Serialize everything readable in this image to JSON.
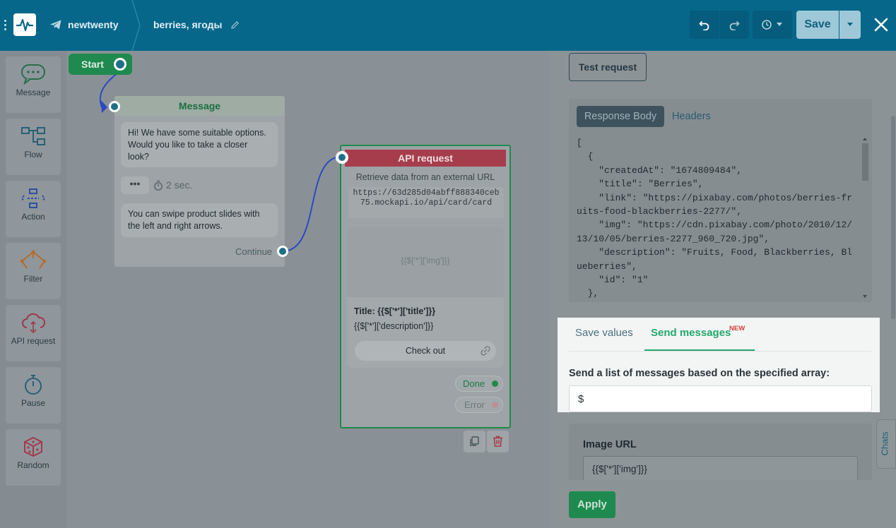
{
  "topbar": {
    "bot_name": "newtwenty",
    "flow_name": "berries, ягоды",
    "save_label": "Save"
  },
  "sidebar": {
    "items": [
      {
        "label": "Message"
      },
      {
        "label": "Flow"
      },
      {
        "label": "Action"
      },
      {
        "label": "Filter"
      },
      {
        "label": "API request"
      },
      {
        "label": "Pause"
      },
      {
        "label": "Random"
      }
    ]
  },
  "canvas": {
    "start_label": "Start",
    "message_node": {
      "title": "Message",
      "text1": "Hi! We have some suitable options. Would you like to take a closer look?",
      "delay": "2 sec.",
      "text2": "You can swipe product slides with the left and right arrows.",
      "continue_label": "Continue"
    },
    "api_node": {
      "title": "API request",
      "subtitle": "Retrieve data from an external URL",
      "url": "https://63d285d04abff888340ceb75.mockapi.io/api/card/card",
      "image_placeholder": "{{$['*']['img']}}",
      "card_title": "Title: {{$['*']['title']}}",
      "card_desc": "{{$['*']['description']}}",
      "card_button": "Check out",
      "done_label": "Done",
      "error_label": "Error"
    }
  },
  "panel": {
    "test_request_label": "Test request",
    "response_tabs": [
      "Response Body",
      "Headers"
    ],
    "response_lines": [
      "[",
      "  {",
      "    \"createdAt\": \"1674809484\",",
      "    \"title\": \"Berries\",",
      "    \"link\": \"https://pixabay.com/photos/berries-fr",
      "uits-food-blackberries-2277/\",",
      "    \"img\": \"https://cdn.pixabay.com/photo/2010/12/",
      "13/10/05/berries-2277_960_720.jpg\",",
      "    \"description\": \"Fruits, Food, Blackberries, Bl",
      "ueberries\",",
      "    \"id\": \"1\"",
      "  },"
    ],
    "tabs": {
      "save_values": "Save values",
      "send_messages": "Send messages",
      "new_badge": "NEW"
    },
    "array_label": "Send a list of messages based on the specified array:",
    "array_value": "$",
    "image_url_label": "Image URL",
    "image_url_value": "{{$['*']['img']}}",
    "apply_label": "Apply",
    "chats_label": "Chats"
  }
}
